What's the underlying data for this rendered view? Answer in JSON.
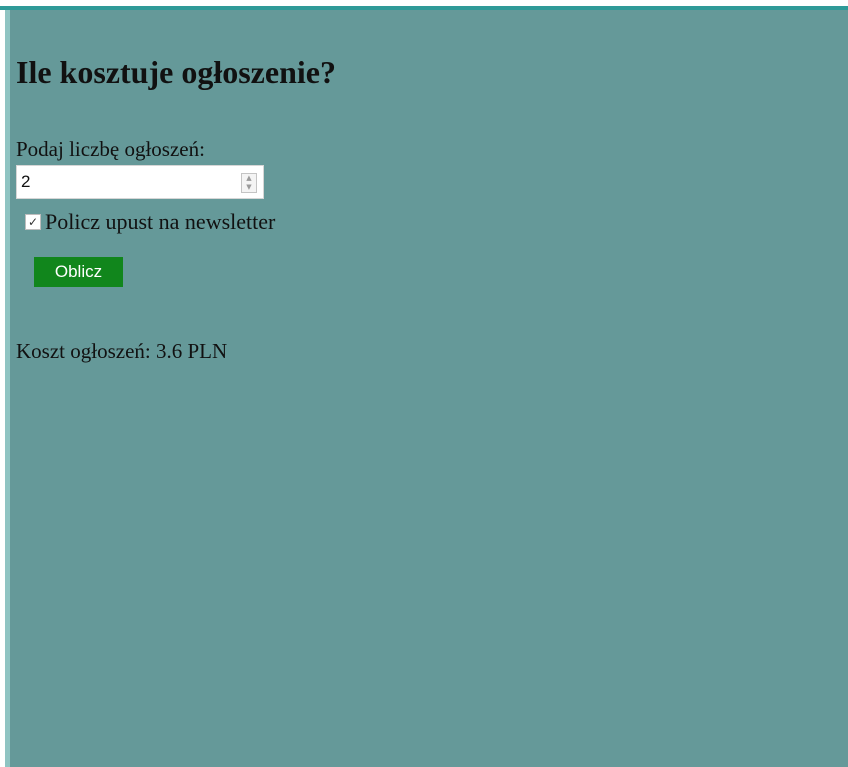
{
  "page": {
    "title": "Ile kosztuje ogłoszenie?",
    "background_color": "#659999",
    "accent_bar_color": "#2f9a98"
  },
  "form": {
    "count_label": "Podaj liczbę ogłoszeń:",
    "count_value": "2",
    "spinner_up_icon": "triangle-up-icon",
    "spinner_down_icon": "triangle-down-icon",
    "newsletter_checked": true,
    "newsletter_label": "Policz upust na newsletter",
    "calculate_button_label": "Oblicz",
    "button_color": "#11861c"
  },
  "result": {
    "text": "Koszt ogłoszeń: 3.6 PLN"
  }
}
